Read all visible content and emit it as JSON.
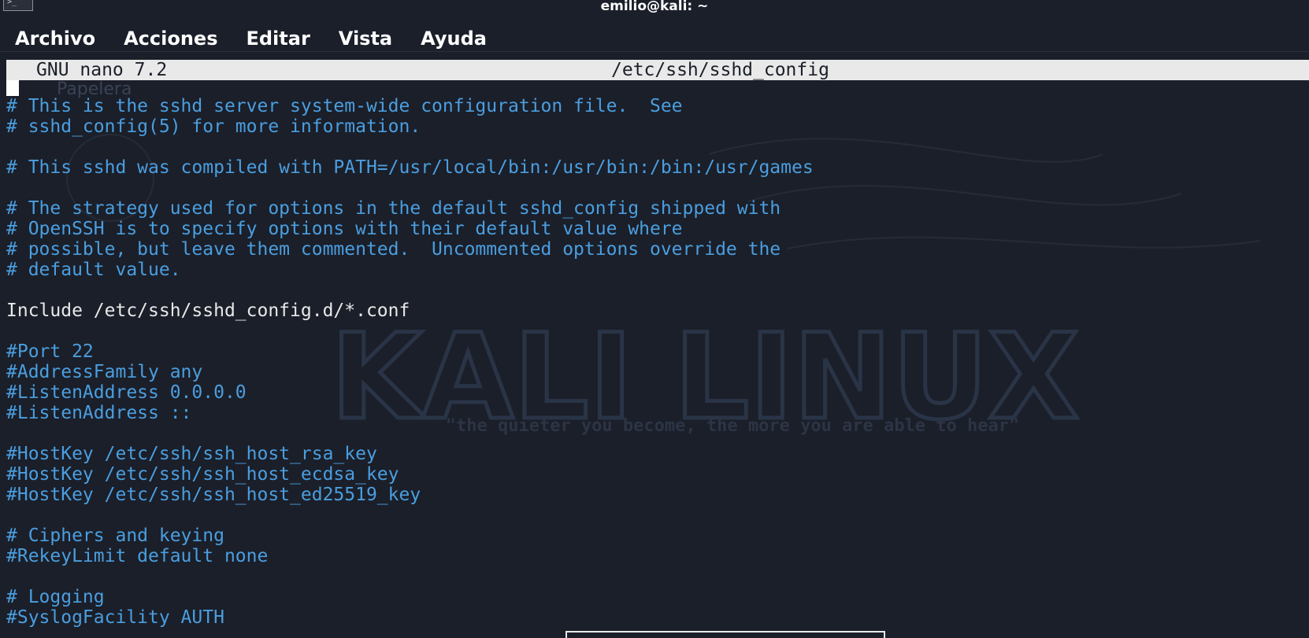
{
  "window": {
    "title": "emilio@kali: ~"
  },
  "menu": {
    "items": [
      "Archivo",
      "Acciones",
      "Editar",
      "Vista",
      "Ayuda"
    ]
  },
  "nano": {
    "version": "GNU nano 7.2",
    "filename": "/etc/ssh/sshd_config"
  },
  "wallpaper": {
    "logo_text": "KALI LINUX",
    "tagline": "\"the quieter you become, the more you are able to hear\"",
    "desktop_labels": [
      "Papelera"
    ]
  },
  "lines": [
    {
      "text": "# This is the sshd server system-wide configuration file.  See",
      "type": "comment"
    },
    {
      "text": "# sshd_config(5) for more information.",
      "type": "comment"
    },
    {
      "text": "",
      "type": "blank"
    },
    {
      "text": "# This sshd was compiled with PATH=/usr/local/bin:/usr/bin:/bin:/usr/games",
      "type": "comment"
    },
    {
      "text": "",
      "type": "blank"
    },
    {
      "text": "# The strategy used for options in the default sshd_config shipped with",
      "type": "comment"
    },
    {
      "text": "# OpenSSH is to specify options with their default value where",
      "type": "comment"
    },
    {
      "text": "# possible, but leave them commented.  Uncommented options override the",
      "type": "comment"
    },
    {
      "text": "# default value.",
      "type": "comment"
    },
    {
      "text": "",
      "type": "blank"
    },
    {
      "text": "Include /etc/ssh/sshd_config.d/*.conf",
      "type": "plain"
    },
    {
      "text": "",
      "type": "blank"
    },
    {
      "text": "#Port 22",
      "type": "comment"
    },
    {
      "text": "#AddressFamily any",
      "type": "comment"
    },
    {
      "text": "#ListenAddress 0.0.0.0",
      "type": "comment"
    },
    {
      "text": "#ListenAddress ::",
      "type": "comment"
    },
    {
      "text": "",
      "type": "blank"
    },
    {
      "text": "#HostKey /etc/ssh/ssh_host_rsa_key",
      "type": "comment"
    },
    {
      "text": "#HostKey /etc/ssh/ssh_host_ecdsa_key",
      "type": "comment"
    },
    {
      "text": "#HostKey /etc/ssh/ssh_host_ed25519_key",
      "type": "comment"
    },
    {
      "text": "",
      "type": "blank"
    },
    {
      "text": "# Ciphers and keying",
      "type": "comment"
    },
    {
      "text": "#RekeyLimit default none",
      "type": "comment"
    },
    {
      "text": "",
      "type": "blank"
    },
    {
      "text": "# Logging",
      "type": "comment"
    },
    {
      "text": "#SyslogFacility AUTH",
      "type": "comment"
    }
  ]
}
